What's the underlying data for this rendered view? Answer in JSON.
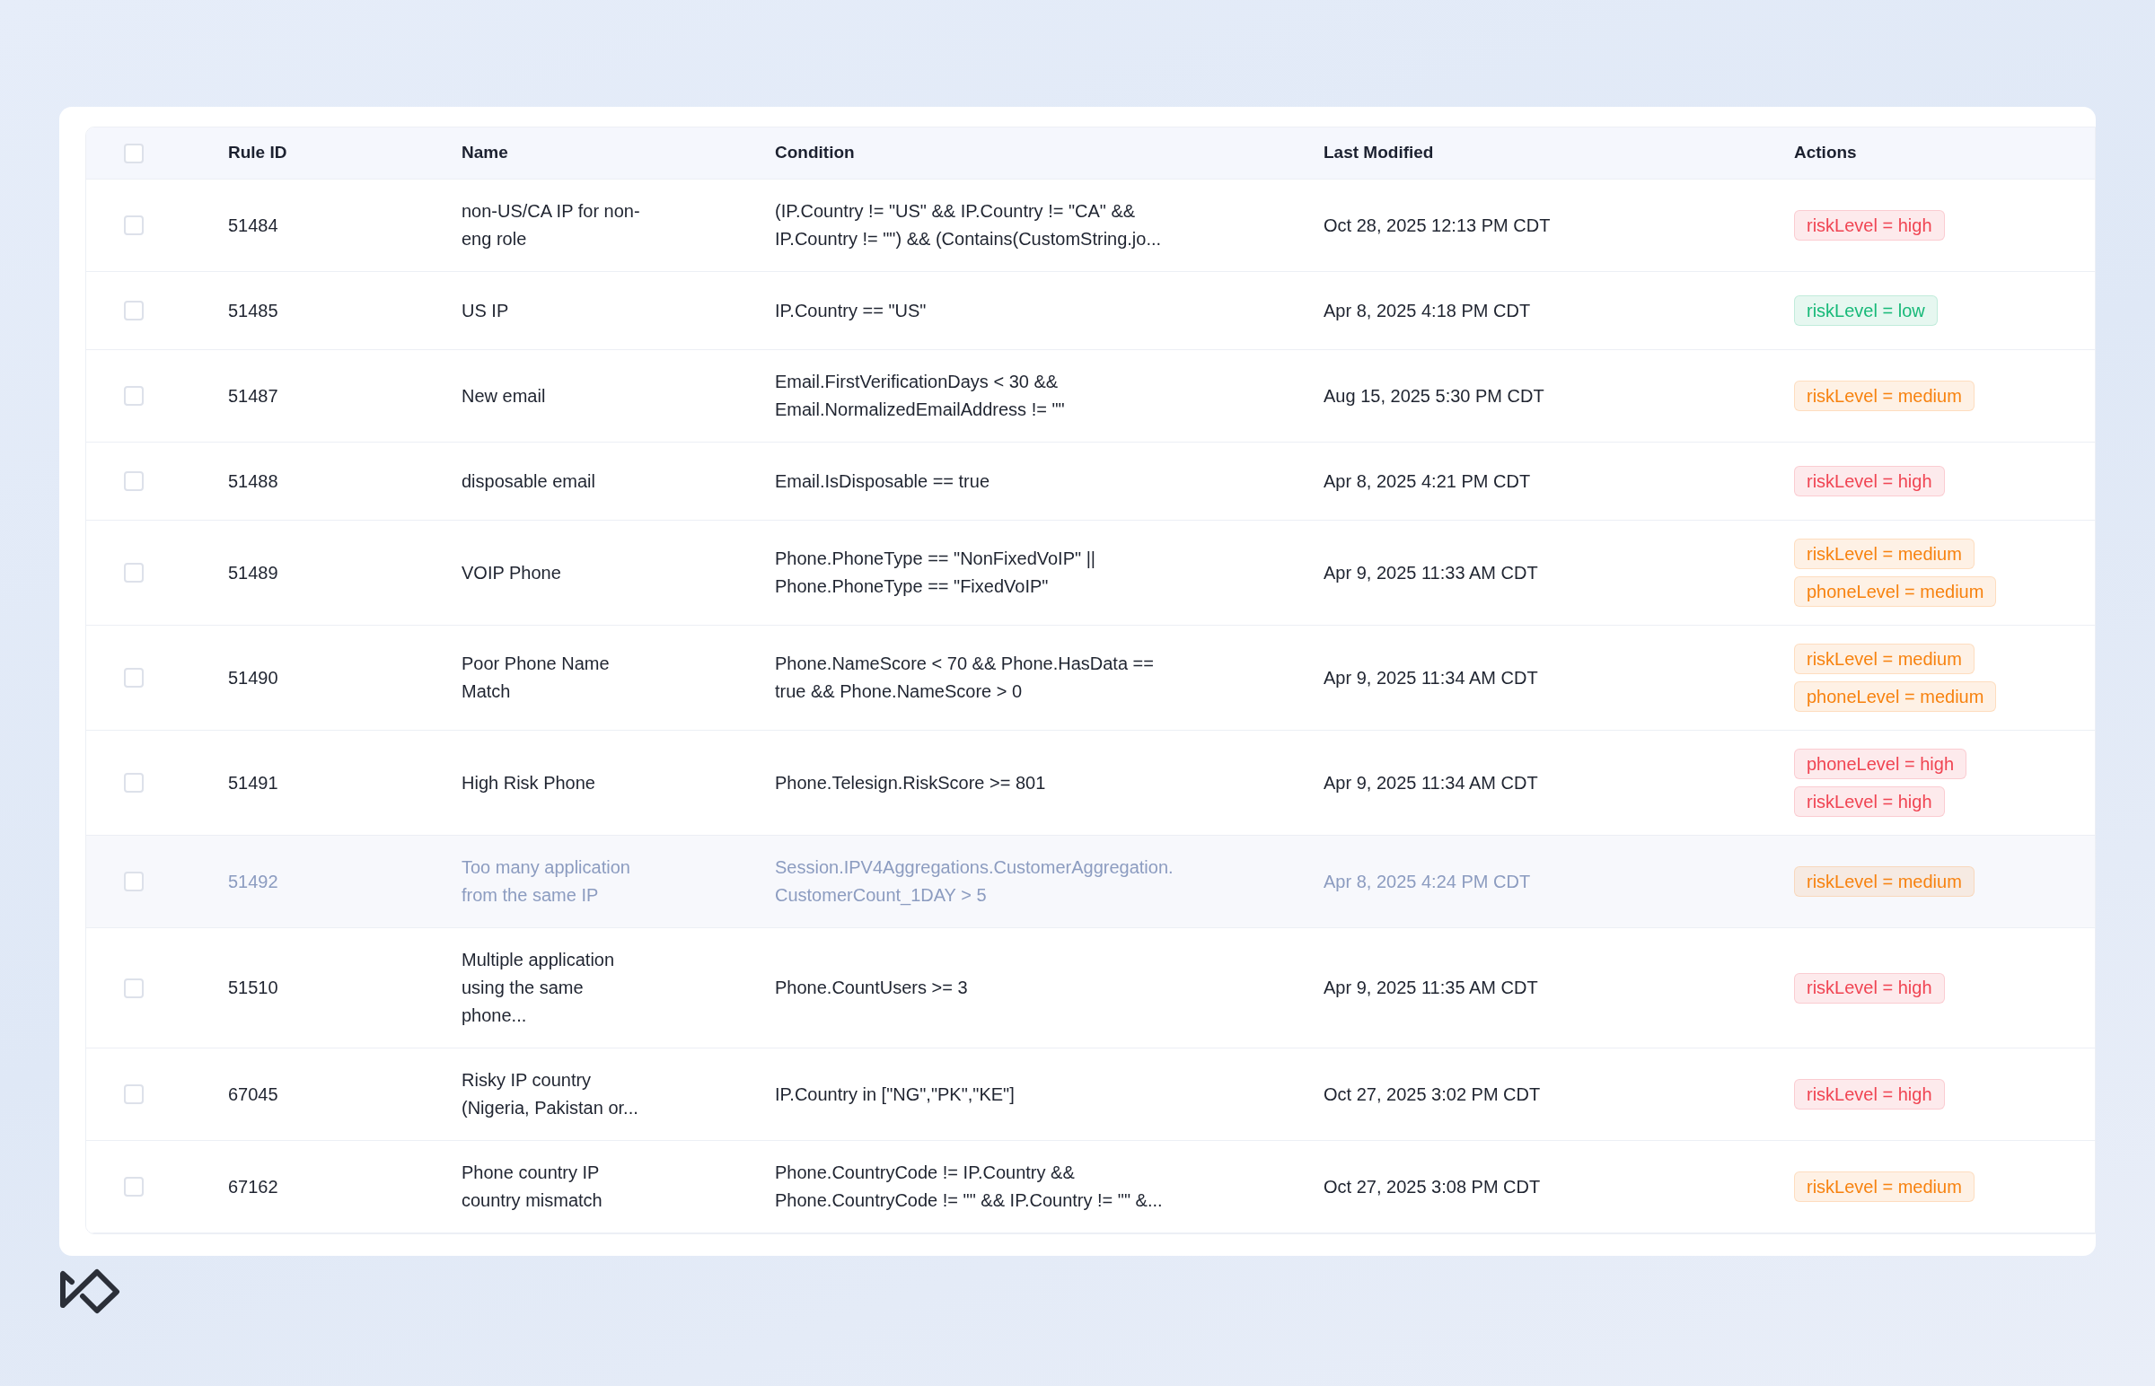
{
  "table": {
    "header_checked": false,
    "columns": [
      "Rule ID",
      "Name",
      "Condition",
      "Last Modified",
      "Actions"
    ],
    "rows": [
      {
        "checked": false,
        "disabled": false,
        "rule_id": "51484",
        "name": "non-US/CA IP for non-eng role",
        "condition": "(IP.Country != \"US\" && IP.Country != \"CA\" && IP.Country != \"\") && (Contains(CustomString.jo...",
        "last_modified": "Oct 28, 2025 12:13 PM CDT",
        "actions": [
          {
            "text": "riskLevel = high",
            "color": "#f04452"
          }
        ]
      },
      {
        "checked": false,
        "disabled": false,
        "rule_id": "51485",
        "name": "US IP",
        "condition": "IP.Country == \"US\"",
        "last_modified": "Apr 8, 2025 4:18 PM CDT",
        "actions": [
          {
            "text": "riskLevel = low",
            "color": "#17b978"
          }
        ]
      },
      {
        "checked": false,
        "disabled": false,
        "rule_id": "51487",
        "name": "New email",
        "condition": "Email.FirstVerificationDays < 30 && Email.NormalizedEmailAddress != \"\"",
        "last_modified": "Aug 15, 2025 5:30 PM CDT",
        "actions": [
          {
            "text": "riskLevel = medium",
            "color": "#f7820f"
          }
        ]
      },
      {
        "checked": false,
        "disabled": false,
        "rule_id": "51488",
        "name": "disposable email",
        "condition": "Email.IsDisposable == true",
        "last_modified": "Apr 8, 2025 4:21 PM CDT",
        "actions": [
          {
            "text": "riskLevel = high",
            "color": "#f04452"
          }
        ]
      },
      {
        "checked": false,
        "disabled": false,
        "rule_id": "51489",
        "name": "VOIP Phone",
        "condition": "Phone.PhoneType == \"NonFixedVoIP\" || Phone.PhoneType == \"FixedVoIP\"",
        "last_modified": "Apr 9, 2025 11:33 AM CDT",
        "actions": [
          {
            "text": "riskLevel = medium",
            "color": "#f7820f"
          },
          {
            "text": "phoneLevel = medium",
            "color": "#f7820f"
          }
        ]
      },
      {
        "checked": false,
        "disabled": false,
        "rule_id": "51490",
        "name": "Poor Phone Name Match",
        "condition": "Phone.NameScore < 70 && Phone.HasData == true && Phone.NameScore > 0",
        "last_modified": "Apr 9, 2025 11:34 AM CDT",
        "actions": [
          {
            "text": "riskLevel = medium",
            "color": "#f7820f"
          },
          {
            "text": "phoneLevel = medium",
            "color": "#f7820f"
          }
        ]
      },
      {
        "checked": false,
        "disabled": false,
        "rule_id": "51491",
        "name": "High Risk Phone",
        "condition": "Phone.Telesign.RiskScore >= 801",
        "last_modified": "Apr 9, 2025 11:34 AM CDT",
        "actions": [
          {
            "text": "phoneLevel = high",
            "color": "#f04452"
          },
          {
            "text": "riskLevel = high",
            "color": "#f04452"
          }
        ]
      },
      {
        "checked": false,
        "disabled": true,
        "rule_id": "51492",
        "name": "Too many application from the same IP",
        "condition": "Session.IPV4Aggregations.CustomerAggregation.CustomerCount_1DAY > 5",
        "last_modified": "Apr 8, 2025 4:24 PM CDT",
        "actions": [
          {
            "text": "riskLevel = medium",
            "color": "#f7820f"
          }
        ]
      },
      {
        "checked": false,
        "disabled": false,
        "rule_id": "51510",
        "name": "Multiple application using the same phone...",
        "condition": "Phone.CountUsers >= 3",
        "last_modified": "Apr 9, 2025 11:35 AM CDT",
        "actions": [
          {
            "text": "riskLevel = high",
            "color": "#f04452"
          }
        ]
      },
      {
        "checked": false,
        "disabled": false,
        "rule_id": "67045",
        "name": "Risky IP country (Nigeria, Pakistan or...",
        "condition": "IP.Country in [\"NG\",\"PK\",\"KE\"]",
        "last_modified": "Oct 27, 2025 3:02 PM CDT",
        "actions": [
          {
            "text": "riskLevel = high",
            "color": "#f04452"
          }
        ]
      },
      {
        "checked": false,
        "disabled": false,
        "rule_id": "67162",
        "name": "Phone country IP country mismatch",
        "condition": "Phone.CountryCode != IP.Country && Phone.CountryCode != \"\" && IP.Country != \"\" &...",
        "last_modified": "Oct 27, 2025 3:08 PM CDT",
        "actions": [
          {
            "text": "riskLevel = medium",
            "color": "#f7820f"
          }
        ]
      }
    ]
  }
}
